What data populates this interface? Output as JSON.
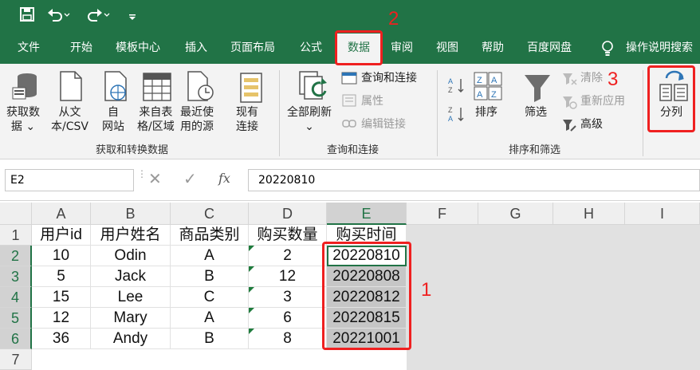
{
  "quick_access": {
    "save_icon": "save-icon",
    "undo_icon": "undo-icon",
    "redo_icon": "redo-icon"
  },
  "tabs": [
    "文件",
    "开始",
    "模板中心",
    "插入",
    "页面布局",
    "公式",
    "数据",
    "审阅",
    "视图",
    "帮助",
    "百度网盘"
  ],
  "active_tab": "数据",
  "tell_me": "操作说明搜索",
  "ribbon": {
    "get_data": "获取数\n据 ⌄",
    "from_text": "从文\n本/CSV",
    "from_web": "自\n网站",
    "from_table": "来自表\n格/区域",
    "recent_sources": "最近使\n用的源",
    "existing_conn": "现有\n连接",
    "group1": "获取和转换数据",
    "refresh_all": "全部刷新\n⌄",
    "queries_conn": "查询和连接",
    "properties": "属性",
    "edit_links": "编辑链接",
    "group2": "查询和连接",
    "sort": "排序",
    "filter": "筛选",
    "clear": "清除",
    "reapply": "重新应用",
    "advanced": "高级",
    "group3": "排序和筛选",
    "text_to_columns": "分列"
  },
  "formula_bar": {
    "name_box": "E2",
    "fx": "fx",
    "value": "20220810"
  },
  "columns": [
    "A",
    "B",
    "C",
    "D",
    "E",
    "F",
    "G",
    "H",
    "I"
  ],
  "rows": [
    "1",
    "2",
    "3",
    "4",
    "5",
    "6",
    "7"
  ],
  "sheet": [
    [
      "用户id",
      "用户姓名",
      "商品类别",
      "购买数量",
      "购买时间"
    ],
    [
      "10",
      "Odin",
      "A",
      "2",
      "20220810"
    ],
    [
      "5",
      "Jack",
      "B",
      "12",
      "20220808"
    ],
    [
      "15",
      "Lee",
      "C",
      "3",
      "20220812"
    ],
    [
      "12",
      "Mary",
      "A",
      "6",
      "20220815"
    ],
    [
      "36",
      "Andy",
      "B",
      "8",
      "20221001"
    ]
  ],
  "annotations": [
    "1",
    "2",
    "3"
  ],
  "colors": {
    "excel_green": "#217346",
    "annotation_red": "#ef2020"
  }
}
